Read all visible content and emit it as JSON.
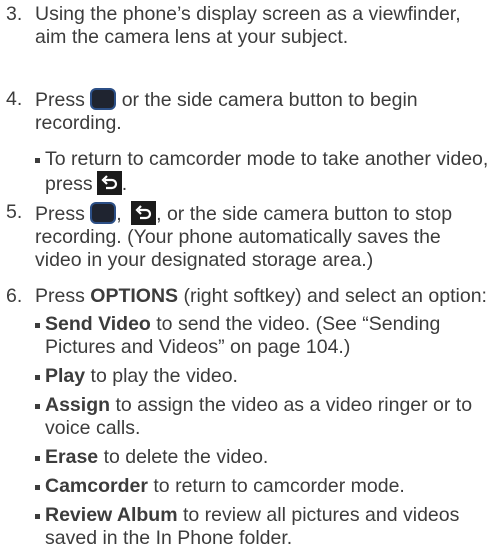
{
  "steps": [
    {
      "num": "3.",
      "text": "Using the phone’s display screen as a viewfinder, aim the camera lens at your subject."
    },
    {
      "num": "4.",
      "pre": "Press",
      "post": "or the side camera button to begin recording."
    },
    {
      "num": "5.",
      "pre": "Press",
      "sep": ",",
      "post": ", or the side camera button to stop recording. (Your phone automatically saves the video in your designated storage area.)"
    },
    {
      "num": "6.",
      "pre": "Press",
      "bold": "OPTIONS",
      "post": "(right softkey) and select an option:"
    }
  ],
  "step4_sub": {
    "pre": "To return to camcorder mode to take another video, press",
    "post": "."
  },
  "options": [
    {
      "bold": "Send Video",
      "text": "to send the video. (See “Sending Pictures and Videos” on page 104.)"
    },
    {
      "bold": "Play",
      "text": "to play the video."
    },
    {
      "bold": "Assign",
      "text": "to assign the video as a video ringer or to voice calls."
    },
    {
      "bold": "Erase",
      "text": "to delete the video."
    },
    {
      "bold": "Camcorder",
      "text": "to return to camcorder mode."
    },
    {
      "bold": "Review Album",
      "text": "to review all pictures and videos saved in the In Phone folder."
    }
  ],
  "icons": {
    "record_key": "center-key-icon",
    "back_key": "back-key-icon",
    "record_key_color": "#1f2430",
    "record_key_border": "#2c4f86",
    "back_key_color": "#1b1b1b"
  }
}
